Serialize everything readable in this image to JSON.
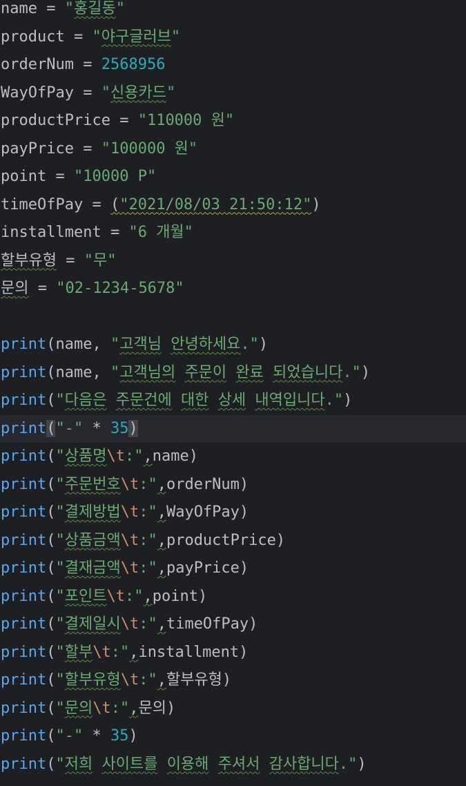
{
  "editor": {
    "colors": {
      "background": "#1e1f22",
      "current_line": "#26282e",
      "identifier": "#bcbec4",
      "string": "#6aab73",
      "number": "#2aacb8",
      "escape": "#cf8e6d",
      "builtin_function": "#56a8f5",
      "typo_underline": "#5f8c4a"
    },
    "current_line_index": 15,
    "lines": [
      [
        {
          "t": "name",
          "k": "id"
        },
        {
          "t": " = ",
          "k": "op"
        },
        {
          "t": "\"",
          "k": "str"
        },
        {
          "t": "홍길동",
          "k": "str",
          "typo": true
        },
        {
          "t": "\"",
          "k": "str"
        }
      ],
      [
        {
          "t": "product",
          "k": "id"
        },
        {
          "t": " = ",
          "k": "op"
        },
        {
          "t": "\"",
          "k": "str"
        },
        {
          "t": "야구글러브",
          "k": "str",
          "typo": true
        },
        {
          "t": "\"",
          "k": "str"
        }
      ],
      [
        {
          "t": "orderNum",
          "k": "id"
        },
        {
          "t": " = ",
          "k": "op"
        },
        {
          "t": "2568956",
          "k": "num"
        }
      ],
      [
        {
          "t": "WayOfPay",
          "k": "id"
        },
        {
          "t": " = ",
          "k": "op"
        },
        {
          "t": "\"",
          "k": "str"
        },
        {
          "t": "신용카드",
          "k": "str",
          "typo": true
        },
        {
          "t": "\"",
          "k": "str"
        }
      ],
      [
        {
          "t": "productPrice",
          "k": "id"
        },
        {
          "t": " = ",
          "k": "op"
        },
        {
          "t": "\"110000 원\"",
          "k": "str"
        }
      ],
      [
        {
          "t": "payPrice",
          "k": "id"
        },
        {
          "t": " = ",
          "k": "op"
        },
        {
          "t": "\"100000 원\"",
          "k": "str"
        }
      ],
      [
        {
          "t": "point",
          "k": "id"
        },
        {
          "t": " = ",
          "k": "op"
        },
        {
          "t": "\"10000 P\"",
          "k": "str"
        }
      ],
      [
        {
          "t": "timeOfPay",
          "k": "id"
        },
        {
          "t": " = ",
          "k": "op"
        },
        {
          "t": "(",
          "k": "paren",
          "warn": true
        },
        {
          "t": "\"2021/08/03 21:50:12\"",
          "k": "str",
          "warn": true
        },
        {
          "t": ")",
          "k": "paren"
        }
      ],
      [
        {
          "t": "installment",
          "k": "id"
        },
        {
          "t": " = ",
          "k": "op"
        },
        {
          "t": "\"6 개월\"",
          "k": "str"
        }
      ],
      [
        {
          "t": "할부유형",
          "k": "id",
          "typo": true
        },
        {
          "t": " = ",
          "k": "op"
        },
        {
          "t": "\"무\"",
          "k": "str"
        }
      ],
      [
        {
          "t": "문의",
          "k": "id",
          "typo": true
        },
        {
          "t": " = ",
          "k": "op"
        },
        {
          "t": "\"02-1234-5678\"",
          "k": "str"
        }
      ],
      [],
      [
        {
          "t": "print",
          "k": "fn"
        },
        {
          "t": "(",
          "k": "paren"
        },
        {
          "t": "name",
          "k": "id"
        },
        {
          "t": ", ",
          "k": "op"
        },
        {
          "t": "\"",
          "k": "str"
        },
        {
          "t": "고객님",
          "k": "str",
          "typo": true
        },
        {
          "t": " ",
          "k": "str"
        },
        {
          "t": "안녕하세요",
          "k": "str",
          "typo": true
        },
        {
          "t": ".\"",
          "k": "str"
        },
        {
          "t": ")",
          "k": "paren"
        }
      ],
      [
        {
          "t": "print",
          "k": "fn"
        },
        {
          "t": "(",
          "k": "paren"
        },
        {
          "t": "name",
          "k": "id"
        },
        {
          "t": ", ",
          "k": "op"
        },
        {
          "t": "\"",
          "k": "str"
        },
        {
          "t": "고객님의",
          "k": "str",
          "typo": true
        },
        {
          "t": " ",
          "k": "str"
        },
        {
          "t": "주문이",
          "k": "str",
          "typo": true
        },
        {
          "t": " ",
          "k": "str"
        },
        {
          "t": "완료",
          "k": "str",
          "typo": true
        },
        {
          "t": " ",
          "k": "str"
        },
        {
          "t": "되었습니다",
          "k": "str",
          "typo": true
        },
        {
          "t": ".\"",
          "k": "str"
        },
        {
          "t": ")",
          "k": "paren"
        }
      ],
      [
        {
          "t": "print",
          "k": "fn"
        },
        {
          "t": "(",
          "k": "paren"
        },
        {
          "t": "\"",
          "k": "str"
        },
        {
          "t": "다음은",
          "k": "str",
          "typo": true
        },
        {
          "t": " ",
          "k": "str"
        },
        {
          "t": "주문건에",
          "k": "str",
          "typo": true
        },
        {
          "t": " ",
          "k": "str"
        },
        {
          "t": "대한",
          "k": "str",
          "typo": true
        },
        {
          "t": " ",
          "k": "str"
        },
        {
          "t": "상세",
          "k": "str",
          "typo": true
        },
        {
          "t": " ",
          "k": "str"
        },
        {
          "t": "내역입니다",
          "k": "str",
          "typo": true
        },
        {
          "t": ".\"",
          "k": "str"
        },
        {
          "t": ")",
          "k": "paren"
        }
      ],
      [
        {
          "t": "print",
          "k": "fn"
        },
        {
          "t": "(",
          "k": "paren",
          "match": true
        },
        {
          "t": "\"-\"",
          "k": "str"
        },
        {
          "t": " * ",
          "k": "op"
        },
        {
          "t": "35",
          "k": "num"
        },
        {
          "t": ")",
          "k": "paren",
          "match": true
        }
      ],
      [
        {
          "t": "print",
          "k": "fn"
        },
        {
          "t": "(",
          "k": "paren"
        },
        {
          "t": "\"",
          "k": "str"
        },
        {
          "t": "상품명",
          "k": "str",
          "typo": true
        },
        {
          "t": "\\t",
          "k": "esc"
        },
        {
          "t": ":\"",
          "k": "str"
        },
        {
          "t": ",",
          "k": "op",
          "typo": true
        },
        {
          "t": "name",
          "k": "id"
        },
        {
          "t": ")",
          "k": "paren"
        }
      ],
      [
        {
          "t": "print",
          "k": "fn"
        },
        {
          "t": "(",
          "k": "paren"
        },
        {
          "t": "\"",
          "k": "str"
        },
        {
          "t": "주문번호",
          "k": "str",
          "typo": true
        },
        {
          "t": "\\t",
          "k": "esc"
        },
        {
          "t": ":\"",
          "k": "str"
        },
        {
          "t": ",",
          "k": "op",
          "typo": true
        },
        {
          "t": "orderNum",
          "k": "id"
        },
        {
          "t": ")",
          "k": "paren"
        }
      ],
      [
        {
          "t": "print",
          "k": "fn"
        },
        {
          "t": "(",
          "k": "paren"
        },
        {
          "t": "\"",
          "k": "str"
        },
        {
          "t": "결제방법",
          "k": "str",
          "typo": true
        },
        {
          "t": "\\t",
          "k": "esc"
        },
        {
          "t": ":\"",
          "k": "str"
        },
        {
          "t": ",",
          "k": "op",
          "typo": true
        },
        {
          "t": "WayOfPay",
          "k": "id"
        },
        {
          "t": ")",
          "k": "paren"
        }
      ],
      [
        {
          "t": "print",
          "k": "fn"
        },
        {
          "t": "(",
          "k": "paren"
        },
        {
          "t": "\"",
          "k": "str"
        },
        {
          "t": "상품금액",
          "k": "str",
          "typo": true
        },
        {
          "t": "\\t",
          "k": "esc"
        },
        {
          "t": ":\"",
          "k": "str"
        },
        {
          "t": ",",
          "k": "op",
          "typo": true
        },
        {
          "t": "productPrice",
          "k": "id"
        },
        {
          "t": ")",
          "k": "paren"
        }
      ],
      [
        {
          "t": "print",
          "k": "fn"
        },
        {
          "t": "(",
          "k": "paren"
        },
        {
          "t": "\"",
          "k": "str"
        },
        {
          "t": "결재금액",
          "k": "str",
          "typo": true
        },
        {
          "t": "\\t",
          "k": "esc"
        },
        {
          "t": ":\"",
          "k": "str"
        },
        {
          "t": ",",
          "k": "op",
          "typo": true
        },
        {
          "t": "payPrice",
          "k": "id"
        },
        {
          "t": ")",
          "k": "paren"
        }
      ],
      [
        {
          "t": "print",
          "k": "fn"
        },
        {
          "t": "(",
          "k": "paren"
        },
        {
          "t": "\"",
          "k": "str"
        },
        {
          "t": "포인트",
          "k": "str",
          "typo": true
        },
        {
          "t": "\\t",
          "k": "esc"
        },
        {
          "t": ":\"",
          "k": "str"
        },
        {
          "t": ",",
          "k": "op",
          "typo": true
        },
        {
          "t": "point",
          "k": "id"
        },
        {
          "t": ")",
          "k": "paren"
        }
      ],
      [
        {
          "t": "print",
          "k": "fn"
        },
        {
          "t": "(",
          "k": "paren"
        },
        {
          "t": "\"",
          "k": "str"
        },
        {
          "t": "결제일시",
          "k": "str",
          "typo": true
        },
        {
          "t": "\\t",
          "k": "esc"
        },
        {
          "t": ":\"",
          "k": "str"
        },
        {
          "t": ",",
          "k": "op",
          "typo": true
        },
        {
          "t": "timeOfPay",
          "k": "id"
        },
        {
          "t": ")",
          "k": "paren"
        }
      ],
      [
        {
          "t": "print",
          "k": "fn"
        },
        {
          "t": "(",
          "k": "paren"
        },
        {
          "t": "\"",
          "k": "str"
        },
        {
          "t": "할부",
          "k": "str",
          "typo": true
        },
        {
          "t": "\\t",
          "k": "esc"
        },
        {
          "t": ":\"",
          "k": "str"
        },
        {
          "t": ",",
          "k": "op",
          "typo": true
        },
        {
          "t": "installment",
          "k": "id"
        },
        {
          "t": ")",
          "k": "paren"
        }
      ],
      [
        {
          "t": "print",
          "k": "fn"
        },
        {
          "t": "(",
          "k": "paren"
        },
        {
          "t": "\"",
          "k": "str"
        },
        {
          "t": "할부유형",
          "k": "str",
          "typo": true
        },
        {
          "t": "\\t",
          "k": "esc"
        },
        {
          "t": ":\"",
          "k": "str"
        },
        {
          "t": ",",
          "k": "op",
          "typo": true
        },
        {
          "t": "할부유형",
          "k": "id"
        },
        {
          "t": ")",
          "k": "paren"
        }
      ],
      [
        {
          "t": "print",
          "k": "fn"
        },
        {
          "t": "(",
          "k": "paren"
        },
        {
          "t": "\"",
          "k": "str"
        },
        {
          "t": "문의",
          "k": "str",
          "typo": true
        },
        {
          "t": "\\t",
          "k": "esc"
        },
        {
          "t": ":\"",
          "k": "str"
        },
        {
          "t": ",",
          "k": "op",
          "typo": true
        },
        {
          "t": "문의",
          "k": "id"
        },
        {
          "t": ")",
          "k": "paren"
        }
      ],
      [
        {
          "t": "print",
          "k": "fn"
        },
        {
          "t": "(",
          "k": "paren"
        },
        {
          "t": "\"-\"",
          "k": "str"
        },
        {
          "t": " * ",
          "k": "op"
        },
        {
          "t": "35",
          "k": "num"
        },
        {
          "t": ")",
          "k": "paren"
        }
      ],
      [
        {
          "t": "print",
          "k": "fn"
        },
        {
          "t": "(",
          "k": "paren"
        },
        {
          "t": "\"",
          "k": "str"
        },
        {
          "t": "저희",
          "k": "str",
          "typo": true
        },
        {
          "t": " ",
          "k": "str"
        },
        {
          "t": "사이트를",
          "k": "str",
          "typo": true
        },
        {
          "t": " ",
          "k": "str"
        },
        {
          "t": "이용해",
          "k": "str",
          "typo": true
        },
        {
          "t": " ",
          "k": "str"
        },
        {
          "t": "주셔서",
          "k": "str",
          "typo": true
        },
        {
          "t": " ",
          "k": "str"
        },
        {
          "t": "감사합니다",
          "k": "str",
          "typo": true
        },
        {
          "t": ".\"",
          "k": "str"
        },
        {
          "t": ")",
          "k": "paren"
        }
      ]
    ]
  }
}
